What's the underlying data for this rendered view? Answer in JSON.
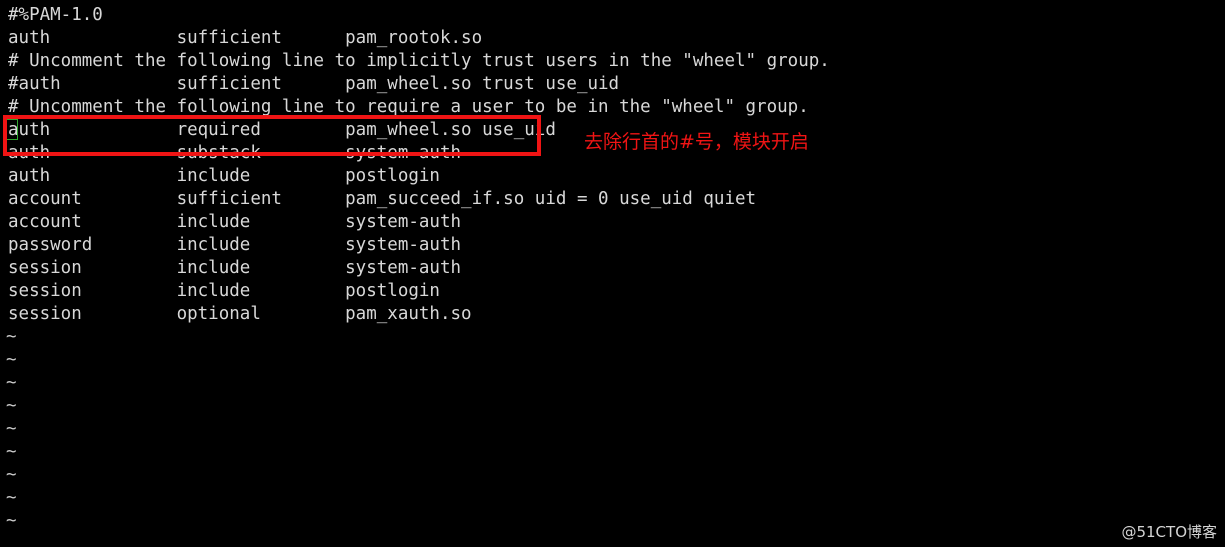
{
  "terminal": {
    "background_color": "#000000",
    "foreground_color": "#d8d8d8",
    "lines": [
      "#%PAM-1.0",
      "auth            sufficient      pam_rootok.so",
      "# Uncomment the following line to implicitly trust users in the \"wheel\" group.",
      "#auth           sufficient      pam_wheel.so trust use_uid",
      "# Uncomment the following line to require a user to be in the \"wheel\" group.",
      "auth            required        pam_wheel.so use_uid",
      "auth            substack        system-auth",
      "auth            include         postlogin",
      "account         sufficient      pam_succeed_if.so uid = 0 use_uid quiet",
      "account         include         system-auth",
      "password        include         system-auth",
      "session         include         system-auth",
      "session         include         postlogin",
      "session         optional        pam_xauth.so"
    ],
    "empty_line_markers": [
      "~",
      "~",
      "~",
      "~",
      "~",
      "~",
      "~",
      "~",
      "~"
    ],
    "cursor": {
      "line_index": 5,
      "column": 0,
      "color": "#2fa82f"
    }
  },
  "annotations": {
    "highlight_box": {
      "color": "#f01414",
      "target_line": "auth            required        pam_wheel.so use_uid"
    },
    "note_text": "去除行首的#号，模块开启",
    "note_color": "#f01414"
  },
  "watermark": {
    "text": "@51CTO博客"
  }
}
